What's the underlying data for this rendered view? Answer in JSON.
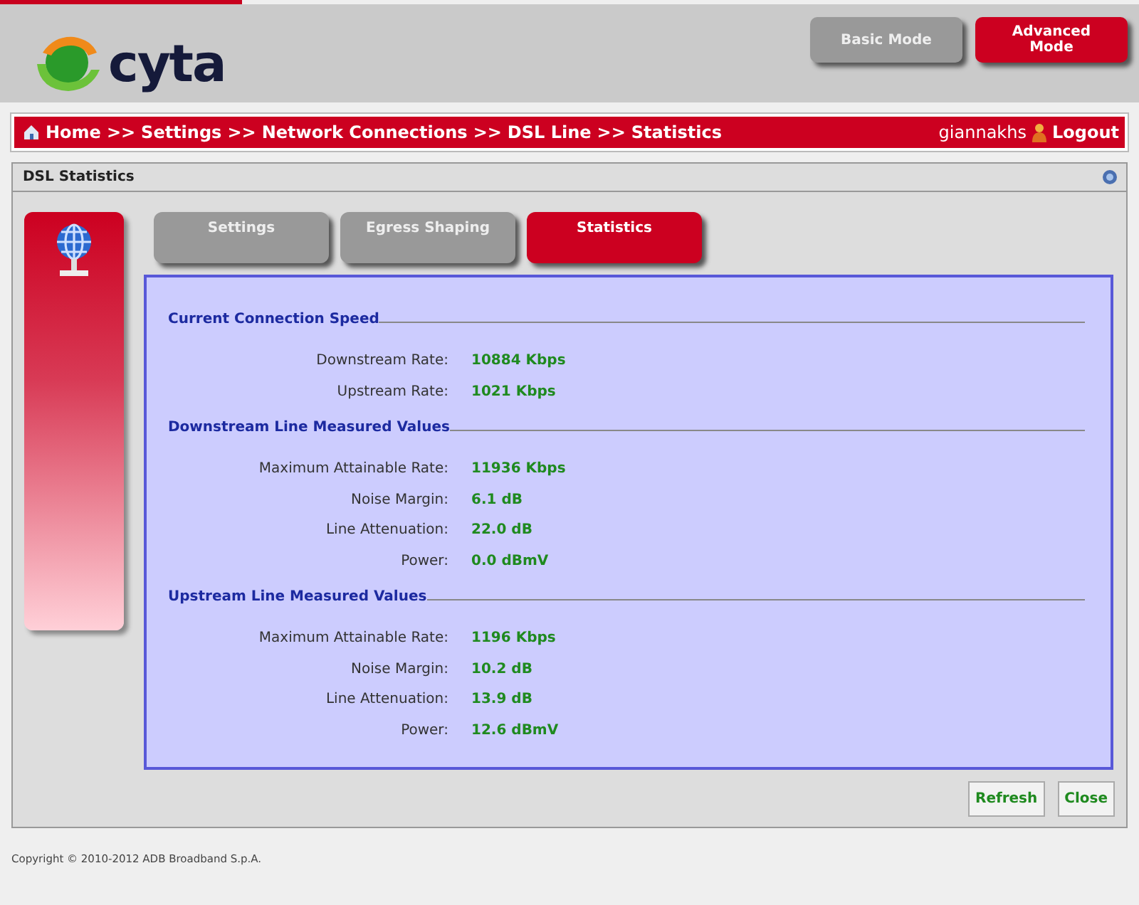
{
  "header": {
    "logo_text": "cyta",
    "modes": [
      {
        "label": "Basic Mode",
        "selected": false
      },
      {
        "label": "Advanced Mode",
        "selected": true
      }
    ]
  },
  "breadcrumb": {
    "items": [
      "Home",
      "Settings",
      "Network Connections",
      "DSL Line",
      "Statistics"
    ],
    "separator": ">>",
    "user": "giannakhs",
    "logout": "Logout"
  },
  "panel": {
    "title": "DSL Statistics",
    "tabs": [
      {
        "label": "Settings",
        "selected": false
      },
      {
        "label": "Egress Shaping",
        "selected": false
      },
      {
        "label": "Statistics",
        "selected": true
      }
    ],
    "sections": [
      {
        "title": "Current Connection Speed",
        "rows": [
          {
            "label": "Downstream Rate:",
            "value": "10884 Kbps"
          },
          {
            "label": "Upstream Rate:",
            "value": "1021 Kbps"
          }
        ]
      },
      {
        "title": "Downstream Line Measured Values",
        "rows": [
          {
            "label": "Maximum Attainable Rate:",
            "value": "11936 Kbps"
          },
          {
            "label": "Noise Margin:",
            "value": "6.1 dB"
          },
          {
            "label": "Line Attenuation:",
            "value": "22.0 dB"
          },
          {
            "label": "Power:",
            "value": "0.0 dBmV"
          }
        ]
      },
      {
        "title": "Upstream Line Measured Values",
        "rows": [
          {
            "label": "Maximum Attainable Rate:",
            "value": "1196 Kbps"
          },
          {
            "label": "Noise Margin:",
            "value": "10.2 dB"
          },
          {
            "label": "Line Attenuation:",
            "value": "13.9 dB"
          },
          {
            "label": "Power:",
            "value": "12.6 dBmV"
          }
        ]
      }
    ],
    "buttons": [
      "Refresh",
      "Close"
    ]
  },
  "footer": "Copyright © 2010-2012 ADB Broadband S.p.A."
}
